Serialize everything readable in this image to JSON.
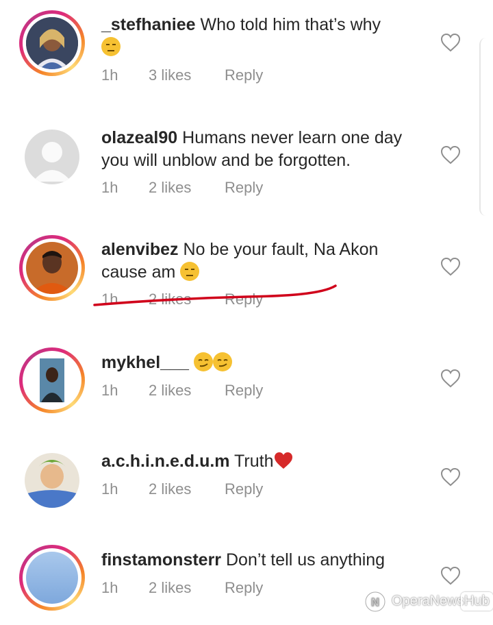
{
  "comments": [
    {
      "username": "_stefhaniee",
      "text": "Who told him that’s why",
      "emoji": "unamused-face-emoji",
      "time": "1h",
      "likes": "3 likes",
      "reply": "Reply",
      "story_ring": true
    },
    {
      "username": "olazeal90",
      "text": "Humans never learn one day you will unblow and be forgotten.",
      "time": "1h",
      "likes": "2 likes",
      "reply": "Reply",
      "story_ring": false
    },
    {
      "username": "alenvibez",
      "text": "No be your fault, Na Akon cause am",
      "emoji": "unamused-face-emoji",
      "time": "1h",
      "likes": "2 likes",
      "reply": "Reply",
      "story_ring": true
    },
    {
      "username": "mykhel___",
      "text": "",
      "emoji": "smirking-face-emoji",
      "time": "1h",
      "likes": "2 likes",
      "reply": "Reply",
      "story_ring": true
    },
    {
      "username": "a.c.h.i.n.e.d.u.m",
      "text": "Truth",
      "emoji": "red-heart-emoji",
      "time": "1h",
      "likes": "2 likes",
      "reply": "Reply",
      "story_ring": false
    },
    {
      "username": "finstamonsterr",
      "text": "Don’t tell us anything",
      "time": "1h",
      "likes": "2 likes",
      "reply": "Reply",
      "story_ring": true
    }
  ],
  "icons": {
    "like": "heart-outline-icon",
    "watermark": "opera-news-logo-icon"
  },
  "colors": {
    "text": "#262626",
    "meta": "#8e8e8e",
    "annotation": "#d0021b"
  },
  "watermark": {
    "text_a": "OperaNews",
    "text_b": "Hub"
  }
}
